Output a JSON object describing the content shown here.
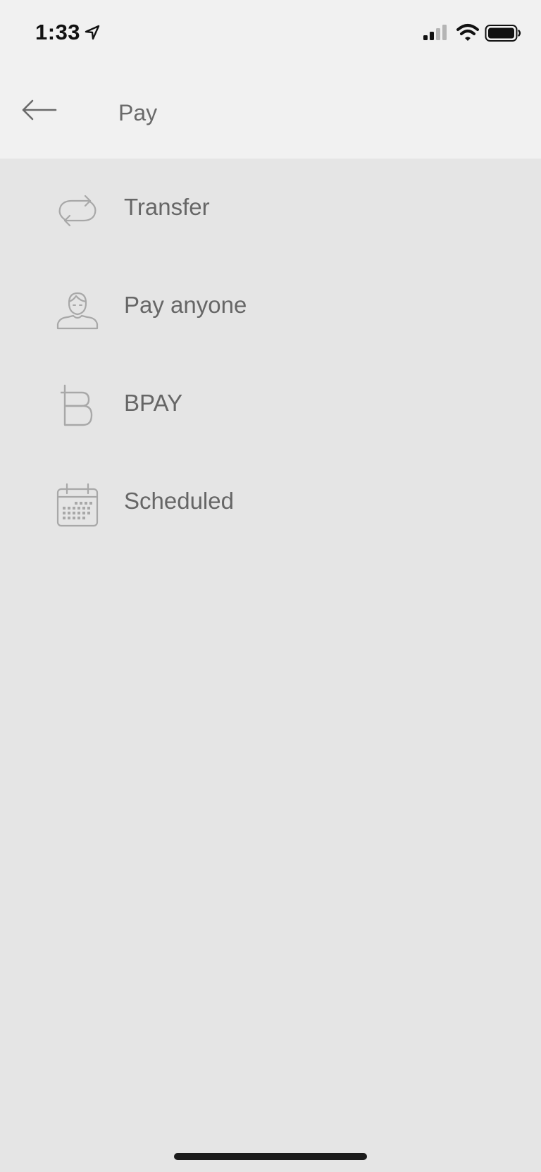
{
  "status_bar": {
    "time": "1:33",
    "location_icon": "location-arrow-icon",
    "signal_icon": "cellular-signal-icon",
    "wifi_icon": "wifi-icon",
    "battery_icon": "battery-icon"
  },
  "header": {
    "back_icon": "arrow-left-icon",
    "title": "Pay"
  },
  "menu": {
    "items": [
      {
        "label": "Transfer",
        "icon": "transfer-arrows-icon"
      },
      {
        "label": "Pay anyone",
        "icon": "person-icon"
      },
      {
        "label": "BPAY",
        "icon": "bpay-icon"
      },
      {
        "label": "Scheduled",
        "icon": "calendar-icon"
      }
    ]
  },
  "colors": {
    "background": "#e5e5e5",
    "header_background": "#f1f1f1",
    "text": "#666666",
    "icon": "#a8a8a8"
  }
}
